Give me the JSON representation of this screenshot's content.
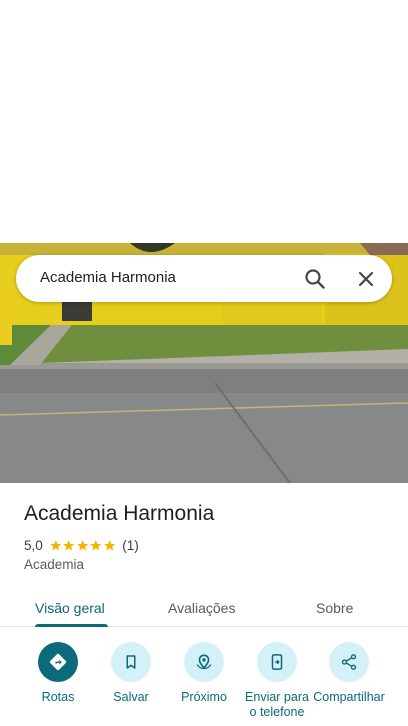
{
  "search": {
    "query": "Academia Harmonia"
  },
  "place": {
    "name": "Academia Harmonia",
    "rating": 5.0,
    "rating_text": "5,0",
    "stars": 5,
    "review_count": "(1)",
    "category": "Academia"
  },
  "tabs": [
    {
      "label": "Visão geral",
      "active": true
    },
    {
      "label": "Avaliações",
      "active": false
    },
    {
      "label": "Sobre",
      "active": false
    }
  ],
  "actions": [
    {
      "label": "Rotas",
      "icon": "directions-icon"
    },
    {
      "label": "Salvar",
      "icon": "bookmark-icon"
    },
    {
      "label": "Próximo",
      "icon": "nearby-icon"
    },
    {
      "label": "Enviar para o telefone",
      "icon": "send-to-phone-icon"
    },
    {
      "label": "Compartilhar",
      "icon": "share-icon"
    }
  ],
  "colors": {
    "accent": "#0b6a7b",
    "action_bg": "#d4f1f7",
    "star": "#f6b400"
  }
}
